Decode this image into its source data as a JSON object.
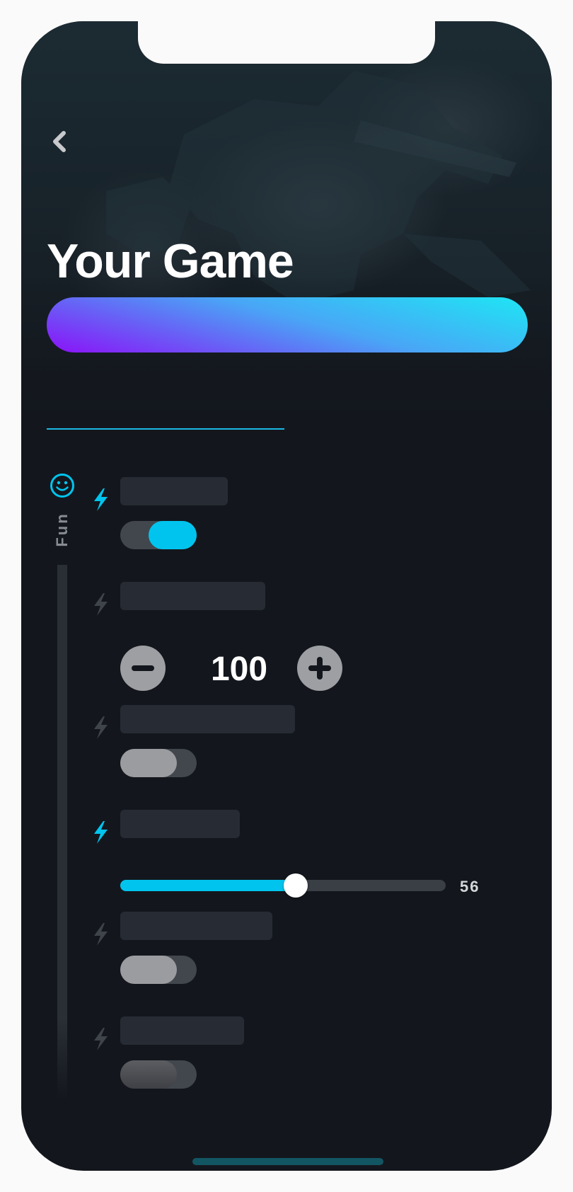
{
  "header": {
    "title": "Your Game",
    "back_icon": "chevron-left-icon"
  },
  "cta_button": {
    "label": "",
    "gradient_colors": [
      "#1ee6f4",
      "#49a6f6",
      "#8b12f7"
    ]
  },
  "tabs": {
    "active_underline_color": "#1bb8e4"
  },
  "category": {
    "label": "Fun",
    "icon": "smiley-icon",
    "accent_color": "#00c4ee"
  },
  "settings": [
    {
      "label": "",
      "bolt_active": true,
      "control": "toggle",
      "checked": true
    },
    {
      "label": "",
      "bolt_active": false,
      "control": "stepper",
      "value": "100"
    },
    {
      "label": "",
      "bolt_active": false,
      "control": "toggle",
      "checked": false
    },
    {
      "label": "",
      "bolt_active": true,
      "control": "slider",
      "value": "56",
      "fraction": 0.54
    },
    {
      "label": "",
      "bolt_active": false,
      "control": "toggle",
      "checked": false
    },
    {
      "label": "",
      "bolt_active": false,
      "control": "toggle",
      "checked": false,
      "dimmed": true
    }
  ],
  "colors": {
    "background": "#13171d",
    "accent": "#00c4ee",
    "inactive": "#9b9ca0"
  }
}
